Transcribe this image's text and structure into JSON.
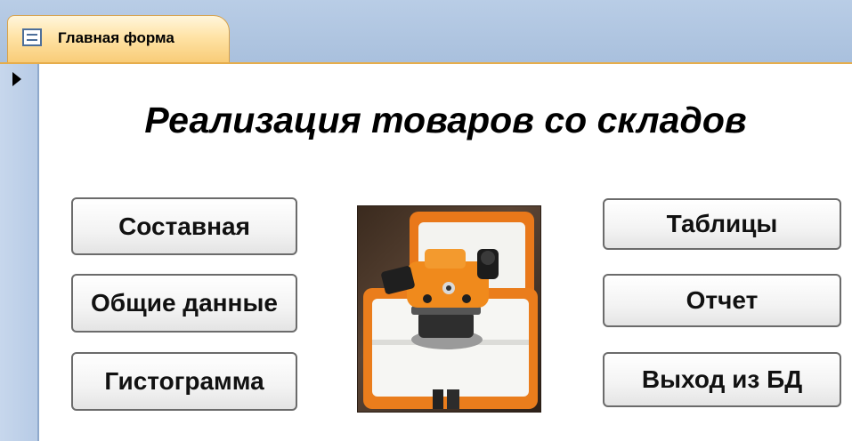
{
  "window": {
    "tab_label": "Главная форма",
    "tab_icon": "form-icon"
  },
  "form": {
    "title": "Реализация товаров со складов",
    "buttons_left": [
      "Составная",
      "Общие данные",
      "Гистограмма"
    ],
    "buttons_right": [
      "Таблицы",
      "Отчет",
      "Выход из БД"
    ],
    "image": "level-instrument-in-case"
  },
  "colors": {
    "tab_accent": "#f8cc78",
    "strip": "#a9c0dd",
    "instrument": "#f08a1c"
  }
}
